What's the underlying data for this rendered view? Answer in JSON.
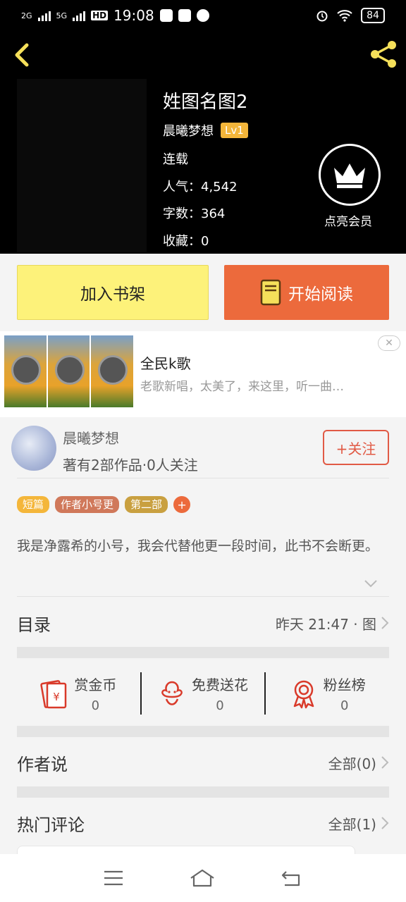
{
  "status_bar": {
    "net1": "2G",
    "net2": "5G",
    "hd": "HD",
    "time": "19:08",
    "battery": "84"
  },
  "book": {
    "title": "姓图名图2",
    "author": "晨曦梦想",
    "level": "Lv1",
    "status": "连载",
    "popularity": "人气：4,542",
    "word_count": "字数：364",
    "favorites": "收藏：0"
  },
  "vip": {
    "label": "点亮会员"
  },
  "actions": {
    "add_shelf": "加入书架",
    "start_read": "开始阅读"
  },
  "ad": {
    "title": "全民k歌",
    "description": "老歌新唱，太美了，来这里，听一曲…",
    "close": "✕"
  },
  "author_info": {
    "name": "晨曦梦想",
    "stats": "著有2部作品·0人关注",
    "follow": "+关注"
  },
  "tags": [
    {
      "label": "短篇",
      "color": "#f4b63a"
    },
    {
      "label": "作者小号更",
      "color": "#d0785a"
    },
    {
      "label": "第二部",
      "color": "#c9a040"
    }
  ],
  "tag_add": "+",
  "description": "我是净露希的小号，我会代替他更一段时间，此书不会断更。",
  "catalog": {
    "title": "目录",
    "latest": "昨天 21:47 · 图"
  },
  "rewards": [
    {
      "label": "赏金币",
      "value": "0",
      "icon": "red-envelope-icon"
    },
    {
      "label": "免费送花",
      "value": "0",
      "icon": "flower-icon"
    },
    {
      "label": "粉丝榜",
      "value": "0",
      "icon": "medal-icon"
    }
  ],
  "author_says": {
    "title": "作者说",
    "count": "全部(0)"
  },
  "hot_comments": {
    "title": "热门评论",
    "count": "全部(1)"
  },
  "colors": {
    "accent_orange": "#ec6a3c",
    "shelf_yellow": "#fdf27a",
    "follow_red": "#e15a45",
    "icon_red": "#d93a2a"
  }
}
